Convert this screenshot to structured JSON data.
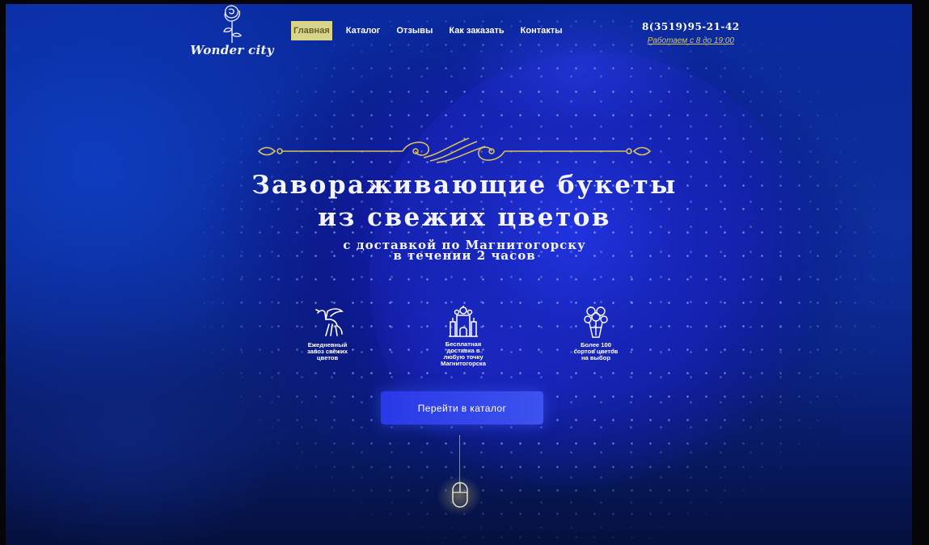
{
  "brand": {
    "logo_text": "Wonder city",
    "logo_icon": "rose-icon"
  },
  "nav": {
    "items": [
      "Главная",
      "Каталог",
      "Отзывы",
      "Как заказать",
      "Контакты"
    ],
    "active_index": 0
  },
  "contact": {
    "phone": "8(3519)95-21-42",
    "hours": "Работаем с 8 до 19:00"
  },
  "hero": {
    "title_line1": "Завораживающие букеты",
    "title_line2": "из свежих цветов",
    "subtitle_line1": "с доставкой по Магнитогорску",
    "subtitle_line2": "в течении 2 часов"
  },
  "features": [
    {
      "icon": "pegasus-icon",
      "text": "Ежедневный\nзавоз свежих\nцветов"
    },
    {
      "icon": "castle-icon",
      "text": "Бесплатная\nдоставка в\nлюбую точку\nМагнитогорска"
    },
    {
      "icon": "bouquet-icon",
      "text": "Более 100\nсортов цветов\nна выбор"
    }
  ],
  "cta": {
    "label": "Перейти в каталог"
  },
  "scroll": {
    "icon": "mouse-scroll-icon"
  },
  "colors": {
    "accent_gold": "#d8d48a",
    "button_blue": "#2a39e8",
    "hero_blue": "#0b2790"
  }
}
